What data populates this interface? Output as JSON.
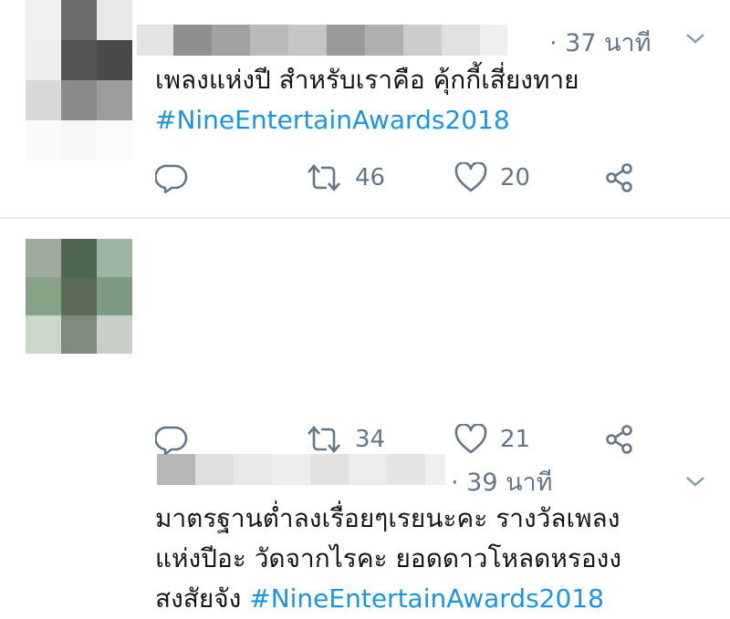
{
  "tweets": [
    {
      "time": "· 37 นาที",
      "text": "เพลงแห่งปี สำหรับเราคือ คุ้กกี้เสี่ยงทาย",
      "hashtag": "#NineEntertainAwards2018",
      "retweets": "46",
      "likes": "20"
    },
    {
      "time": "· 39 นาที",
      "text_lines": [
        "มาตรฐานต่ำลงเรื่อยๆเรยนะคะ รางวัลเพลง",
        "แห่งปีอะ วัดจากไรคะ ยอดดาวโหลดหรองง"
      ],
      "text_last": "สงสัยจัง",
      "hashtag": "#NineEntertainAwards2018",
      "retweets": "34",
      "likes": "21"
    }
  ],
  "icons": {
    "reply": "reply-icon",
    "retweet": "retweet-icon",
    "like": "heart-icon",
    "share": "share-icon",
    "menu": "chevron-down-icon"
  },
  "colors": {
    "hashtag": "#1b95e0",
    "meta": "#657786",
    "text": "#14171a",
    "divider": "#e6ecf0"
  }
}
